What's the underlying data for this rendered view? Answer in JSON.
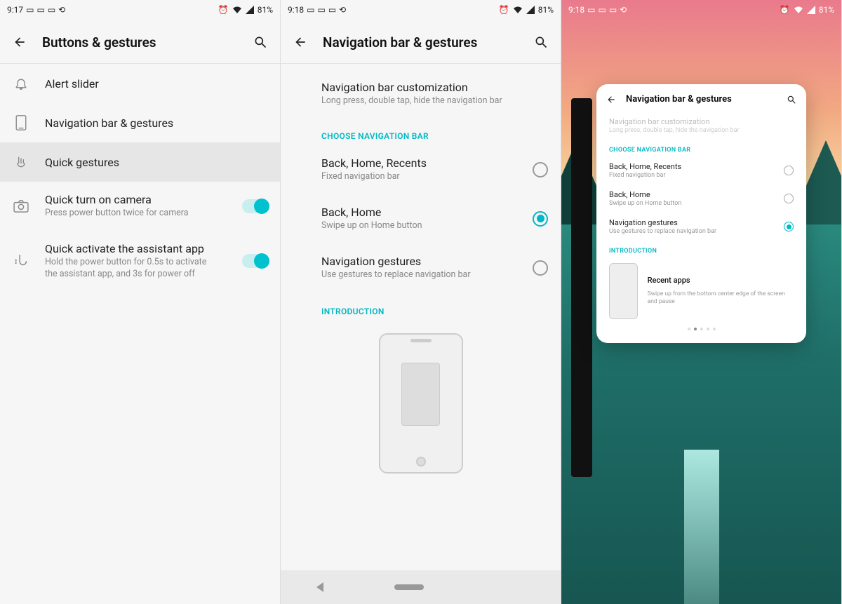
{
  "status": {
    "time1": "9:17",
    "time2": "9:18",
    "time3": "9:18",
    "battery": "81%"
  },
  "screen1": {
    "title": "Buttons & gestures",
    "items": {
      "alert_slider": "Alert slider",
      "nav_bar": "Navigation bar & gestures",
      "quick_gestures": "Quick gestures",
      "quick_camera_label": "Quick turn on camera",
      "quick_camera_sub": "Press power button twice for camera",
      "assistant_label": "Quick activate the assistant app",
      "assistant_sub": "Hold the power button for 0.5s to activate the assistant app, and 3s for power off"
    }
  },
  "screen2": {
    "title": "Navigation bar & gestures",
    "customization_label": "Navigation bar customization",
    "customization_sub": "Long press, double tap, hide the navigation bar",
    "section_choose": "CHOOSE NAVIGATION BAR",
    "opt1_label": "Back, Home, Recents",
    "opt1_sub": "Fixed navigation bar",
    "opt2_label": "Back, Home",
    "opt2_sub": "Swipe up on Home button",
    "opt3_label": "Navigation gestures",
    "opt3_sub": "Use gestures to replace navigation bar",
    "section_intro": "INTRODUCTION"
  },
  "screen3": {
    "title": "Navigation bar & gestures",
    "customization_label": "Navigation bar customization",
    "customization_sub": "Long press, double tap, hide the navigation bar",
    "section_choose": "CHOOSE NAVIGATION BAR",
    "opt1_label": "Back, Home, Recents",
    "opt1_sub": "Fixed navigation bar",
    "opt2_label": "Back, Home",
    "opt2_sub": "Swipe up on Home button",
    "opt3_label": "Navigation gestures",
    "opt3_sub": "Use gestures to replace navigation bar",
    "section_intro": "INTRODUCTION",
    "intro_title": "Recent apps",
    "intro_sub": "Swipe up from the bottom center edge of the screen and pause"
  }
}
